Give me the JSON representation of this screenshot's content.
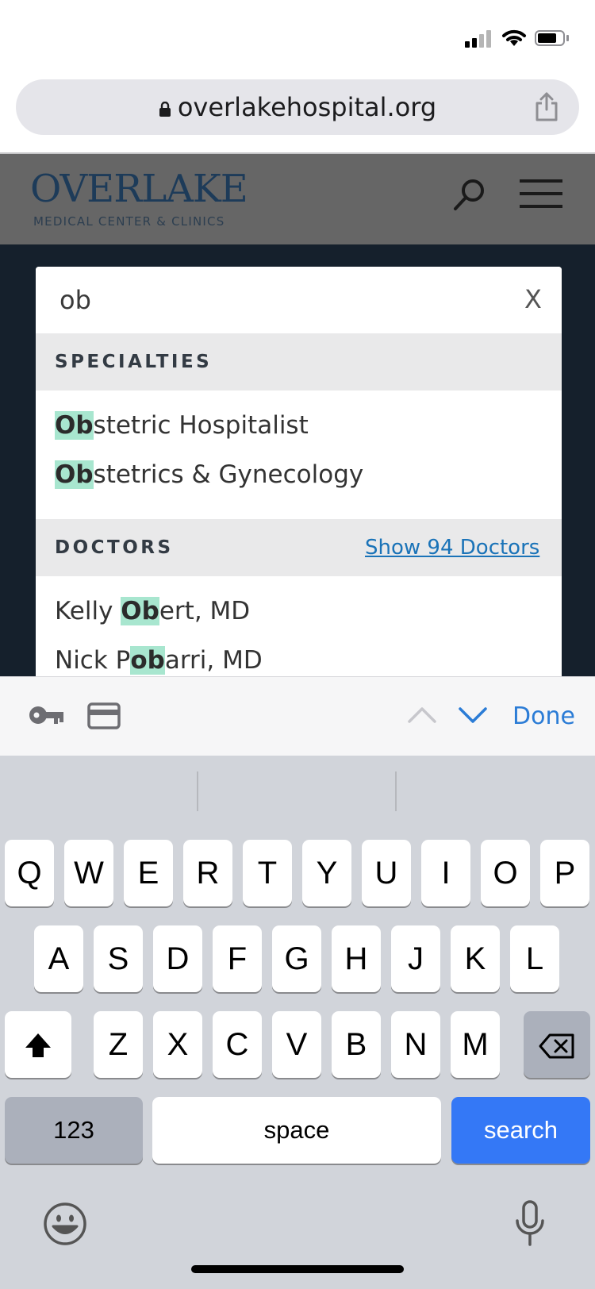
{
  "browser": {
    "url": "overlakehospital.org"
  },
  "site": {
    "logo_main": "OVERLAKE",
    "logo_sub": "MEDICAL CENTER & CLINICS"
  },
  "search": {
    "query": "ob",
    "clear_label": "X",
    "specialties": {
      "title": "SPECIALTIES",
      "items": [
        {
          "match": "Ob",
          "rest": "stetric Hospitalist"
        },
        {
          "match": "Ob",
          "rest": "stetrics & Gynecology"
        }
      ]
    },
    "doctors": {
      "title": "DOCTORS",
      "show_all": "Show 94 Doctors",
      "items": [
        {
          "before": "Kelly ",
          "match": "Ob",
          "after": "ert, MD"
        },
        {
          "before": "Nick P",
          "match": "ob",
          "after": "arri, MD"
        }
      ]
    }
  },
  "accessory": {
    "done_label": "Done"
  },
  "keyboard": {
    "row1": [
      "Q",
      "W",
      "E",
      "R",
      "T",
      "Y",
      "U",
      "I",
      "O",
      "P"
    ],
    "row2": [
      "A",
      "S",
      "D",
      "F",
      "G",
      "H",
      "J",
      "K",
      "L"
    ],
    "row3": [
      "Z",
      "X",
      "C",
      "V",
      "B",
      "N",
      "M"
    ],
    "numbers_label": "123",
    "space_label": "space",
    "search_label": "search"
  },
  "colors": {
    "highlight": "#a8e6cf",
    "link": "#1a73b8",
    "search_key": "#3478f6"
  }
}
